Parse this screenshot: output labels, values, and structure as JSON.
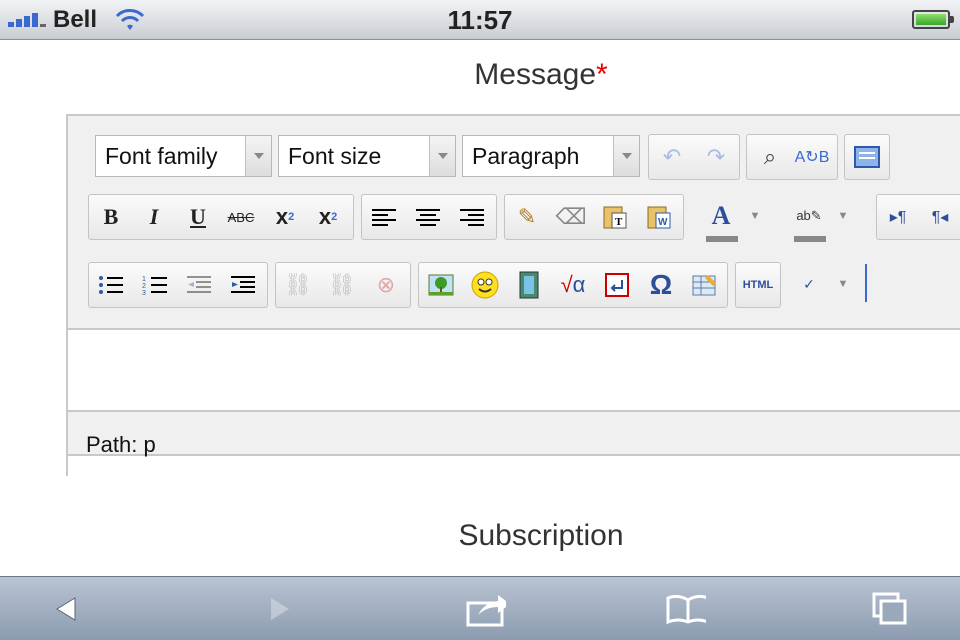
{
  "status": {
    "carrier": "Bell",
    "time": "11:57"
  },
  "form": {
    "message_label": "Message",
    "required_mark": "*",
    "subscription_label": "Subscription"
  },
  "editor": {
    "font_family": "Font family",
    "font_size": "Font size",
    "format": "Paragraph",
    "path": "Path: p",
    "html_button": "HTML",
    "omega": "Ω"
  }
}
